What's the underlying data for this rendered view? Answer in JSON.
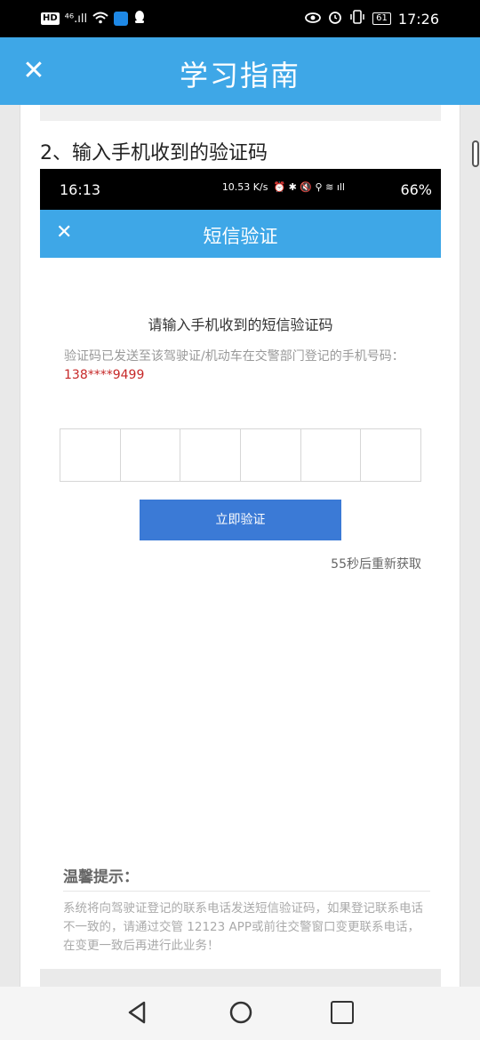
{
  "status_bar": {
    "hd": "HD",
    "signal": "⁴⁶.ıll",
    "battery": "61",
    "time": "17:26"
  },
  "app_bar": {
    "close": "✕",
    "title": "学习指南"
  },
  "content": {
    "step_heading": "2、输入手机收到的验证码",
    "screenshot": {
      "status": {
        "time": "16:13",
        "speed": "10.53 K/s",
        "battery_pct": "66%"
      },
      "title_bar": {
        "close": "✕",
        "title": "短信验证"
      },
      "prompt": "请输入手机收到的短信验证码",
      "info": "验证码已发送至该驾驶证/机动车在交警部门登记的手机号码：",
      "phone": "138****9499",
      "verify_button": "立即验证",
      "resend": "55秒后重新获取",
      "tips_title": "温馨提示：",
      "tips_body": "系统将向驾驶证登记的联系电话发送短信验证码，如果登记联系电话不一致的，请通过交管 12123 APP或前往交警窗口变更联系电话，在变更一致后再进行此业务！"
    }
  },
  "nav_bar": {
    "back_icon": "back-triangle-icon",
    "home_icon": "home-circle-icon",
    "recent_icon": "recent-square-icon"
  },
  "colors": {
    "accent": "#3ea7e7",
    "button": "#3b7ad6",
    "phone": "#c62828"
  }
}
